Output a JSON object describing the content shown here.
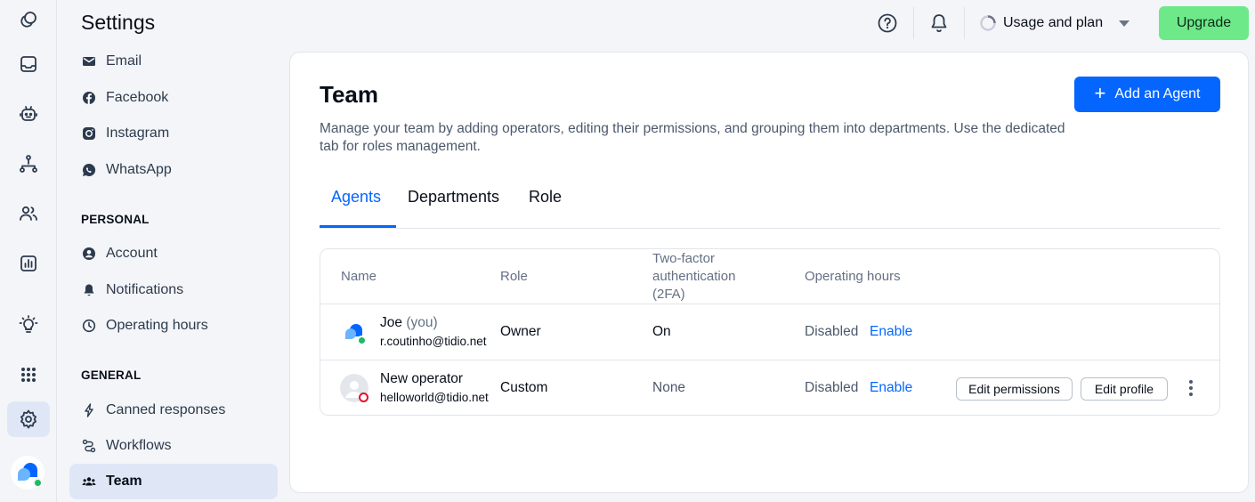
{
  "sidebar": {
    "title": "Settings",
    "channels": [
      {
        "label": "Email",
        "icon": "email-icon"
      },
      {
        "label": "Facebook",
        "icon": "facebook-icon"
      },
      {
        "label": "Instagram",
        "icon": "instagram-icon"
      },
      {
        "label": "WhatsApp",
        "icon": "whatsapp-icon"
      }
    ],
    "personal_heading": "PERSONAL",
    "personal": [
      {
        "label": "Account",
        "icon": "account-icon"
      },
      {
        "label": "Notifications",
        "icon": "bell-icon"
      },
      {
        "label": "Operating hours",
        "icon": "clock-icon"
      }
    ],
    "general_heading": "GENERAL",
    "general": [
      {
        "label": "Canned responses",
        "icon": "lightning-icon"
      },
      {
        "label": "Workflows",
        "icon": "workflow-icon"
      },
      {
        "label": "Team",
        "icon": "team-icon",
        "active": true
      }
    ]
  },
  "topbar": {
    "usage_label": "Usage and plan",
    "upgrade_label": "Upgrade"
  },
  "main": {
    "title": "Team",
    "description": "Manage your team by adding operators, editing their permissions, and grouping them into departments. Use the dedicated tab for roles management.",
    "add_agent_label": "Add an Agent",
    "tabs": [
      {
        "label": "Agents",
        "active": true
      },
      {
        "label": "Departments"
      },
      {
        "label": "Role"
      }
    ],
    "table": {
      "columns": {
        "name": "Name",
        "role": "Role",
        "twofa_1": "Two-factor",
        "twofa_2": "authentication",
        "twofa_3": "(2FA)",
        "hours": "Operating hours"
      },
      "rows": [
        {
          "name": "Joe",
          "you_suffix": "(you)",
          "email": "r.coutinho@tidio.net",
          "role": "Owner",
          "twofa": "On",
          "hours_status": "Disabled",
          "hours_action": "Enable",
          "online": true
        },
        {
          "name": "New operator",
          "email": "helloworld@tidio.net",
          "role": "Custom",
          "twofa": "None",
          "hours_status": "Disabled",
          "hours_action": "Enable",
          "edit_permissions_label": "Edit permissions",
          "edit_profile_label": "Edit profile",
          "online": false
        }
      ]
    }
  },
  "colors": {
    "accent": "#0566ff",
    "upgrade": "#6ee98a",
    "online": "#1dbb63",
    "offline": "#e5112b"
  }
}
